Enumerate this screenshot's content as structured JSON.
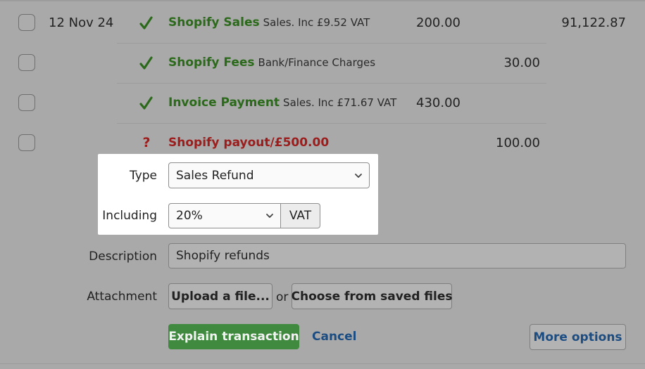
{
  "transactions": [
    {
      "date": "12 Nov 24",
      "status": "check-icon",
      "name": "Shopify Sales",
      "category": "Sales. Inc £9.52 VAT",
      "amount_in": "200.00",
      "balance": "91,122.87"
    },
    {
      "status": "check-icon",
      "name": "Shopify Fees",
      "category": "Bank/Finance Charges",
      "amount_out": "30.00"
    },
    {
      "status": "check-icon",
      "name": "Invoice Payment",
      "category": "Sales. Inc £71.67 VAT",
      "amount_in": "430.00"
    },
    {
      "status": "question-icon",
      "status_glyph": "?",
      "name": "Shopify payout/£500.00",
      "amount_out": "100.00"
    }
  ],
  "form": {
    "type_label": "Type",
    "type_value": "Sales Refund",
    "including_label": "Including",
    "vat_rate": "20%",
    "vat_addon": "VAT",
    "description_label": "Description",
    "description_value": "Shopify refunds",
    "attachment_label": "Attachment",
    "upload_label": "Upload a file...",
    "or_text": "or",
    "choose_label": "Choose from saved files",
    "explain_label": "Explain transaction",
    "cancel_label": "Cancel",
    "more_options_label": "More options"
  },
  "colors": {
    "success": "#2b6a1a",
    "error": "#9d1c1c",
    "primary_button": "#3f8a3e",
    "link": "#1c4d82"
  }
}
